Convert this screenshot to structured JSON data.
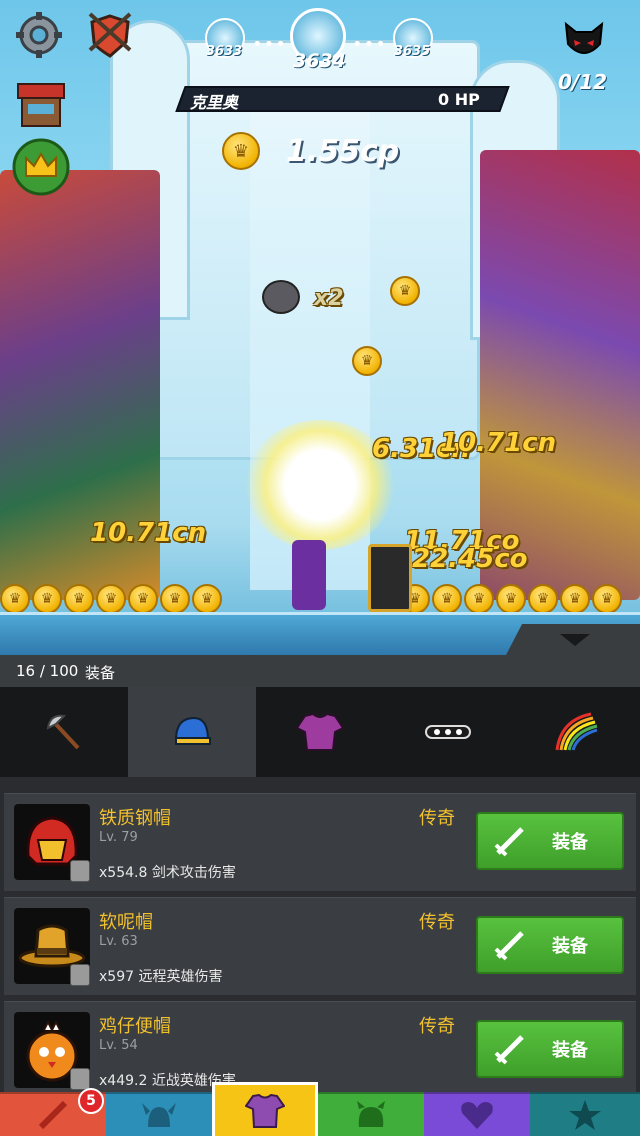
{
  "top": {
    "stages": [
      "3633",
      "3634",
      "3635"
    ],
    "kill_count": "0/12"
  },
  "boss": {
    "name": "克里奥",
    "hp": "0 HP"
  },
  "currency": {
    "value": "1.55cp"
  },
  "damage_texts": [
    "6.31cn",
    "10.71cn",
    "10.71cn",
    "11.71co",
    "22.45co"
  ],
  "multiplier": "x2",
  "equipment": {
    "count": "16 / 100",
    "label": "装备",
    "tabs": [
      "weapon",
      "helmet",
      "armor",
      "accessory",
      "cape"
    ],
    "selected_tab": "helmet",
    "items": [
      {
        "name": "铁质钢帽",
        "level": "Lv. 79",
        "rarity": "传奇",
        "bonus": "x554.8 剑术攻击伤害",
        "button": "装备"
      },
      {
        "name": "软呢帽",
        "level": "Lv. 63",
        "rarity": "传奇",
        "bonus": "x597 远程英雄伤害",
        "button": "装备"
      },
      {
        "name": "鸡仔便帽",
        "level": "Lv. 54",
        "rarity": "传奇",
        "bonus": "x449.2 近战英雄伤害",
        "button": "装备"
      }
    ]
  },
  "nav": {
    "badge": "5",
    "selected": "equipment",
    "colors": [
      "#e2553c",
      "#2b8fb8",
      "#f5c415",
      "#3fae3a",
      "#7a4bd6",
      "#1f7d86"
    ]
  }
}
